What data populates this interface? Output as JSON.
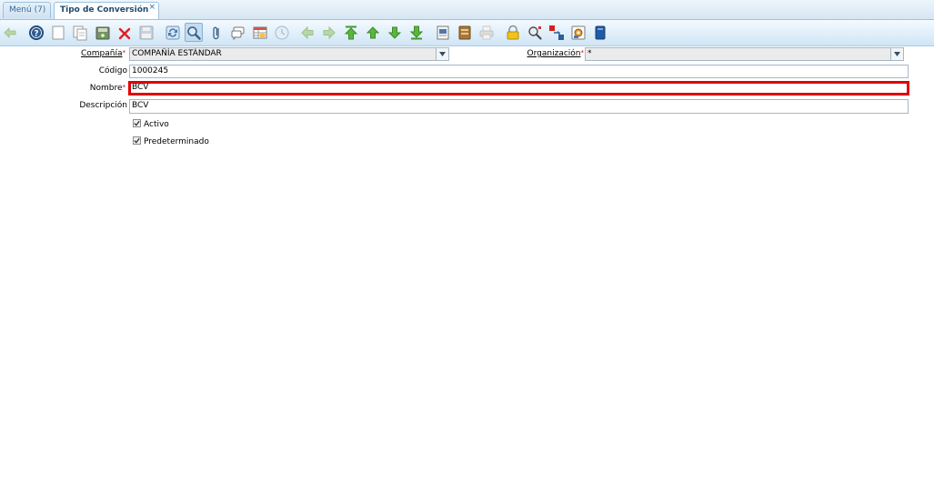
{
  "tabs": {
    "menu": "Menú (7)",
    "active": "Tipo de Conversión",
    "close": "×"
  },
  "toolbar": {
    "icons": [
      "undo-icon",
      "help-icon",
      "new-record-icon",
      "copy-record-icon",
      "save-new-icon",
      "delete-icon",
      "save-icon",
      "refresh-icon",
      "find-icon",
      "attachment-icon",
      "chat-icon",
      "grid-toggle-icon",
      "history-icon",
      "back-icon",
      "forward-icon",
      "first-record-icon",
      "previous-record-icon",
      "next-record-icon",
      "last-record-icon",
      "report-icon",
      "archive-icon",
      "print-icon",
      "lock-icon",
      "zoom-across-icon",
      "workflow-icon",
      "process-icon",
      "product-info-icon"
    ]
  },
  "form": {
    "company_label": "Compañía",
    "company_value": "COMPAÑÍA ESTÁNDAR",
    "org_label": "Organización",
    "org_value": "*",
    "code_label": "Código",
    "code_value": "1000245",
    "name_label": "Nombre",
    "name_value": "BCV",
    "desc_label": "Descripción",
    "desc_value": "BCV",
    "active_label": "Activo",
    "default_label": "Predeterminado",
    "required_mark": "*"
  },
  "colors": {
    "focus_border": "#e00000",
    "tab_accent": "#3b6d99"
  }
}
